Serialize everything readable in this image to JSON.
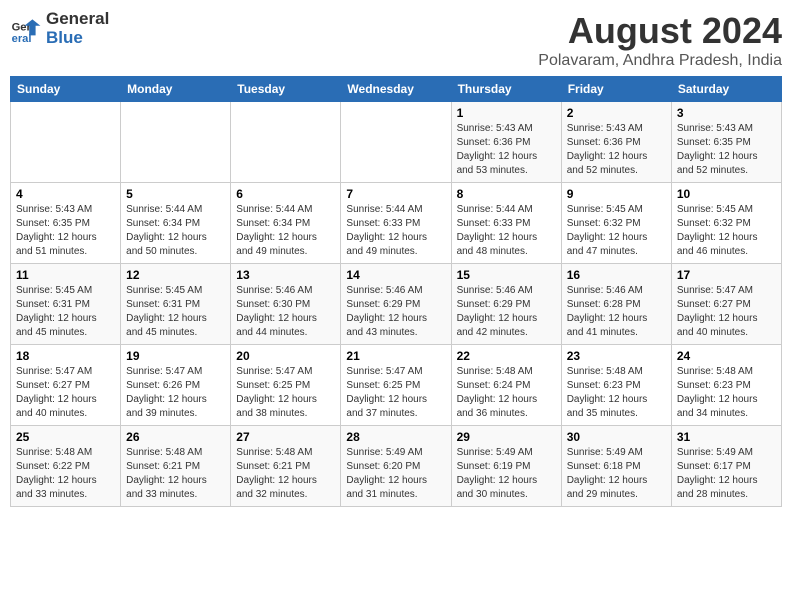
{
  "logo": {
    "general": "General",
    "blue": "Blue"
  },
  "title": "August 2024",
  "subtitle": "Polavaram, Andhra Pradesh, India",
  "weekdays": [
    "Sunday",
    "Monday",
    "Tuesday",
    "Wednesday",
    "Thursday",
    "Friday",
    "Saturday"
  ],
  "weeks": [
    [
      {
        "day": "",
        "info": ""
      },
      {
        "day": "",
        "info": ""
      },
      {
        "day": "",
        "info": ""
      },
      {
        "day": "",
        "info": ""
      },
      {
        "day": "1",
        "info": "Sunrise: 5:43 AM\nSunset: 6:36 PM\nDaylight: 12 hours\nand 53 minutes."
      },
      {
        "day": "2",
        "info": "Sunrise: 5:43 AM\nSunset: 6:36 PM\nDaylight: 12 hours\nand 52 minutes."
      },
      {
        "day": "3",
        "info": "Sunrise: 5:43 AM\nSunset: 6:35 PM\nDaylight: 12 hours\nand 52 minutes."
      }
    ],
    [
      {
        "day": "4",
        "info": "Sunrise: 5:43 AM\nSunset: 6:35 PM\nDaylight: 12 hours\nand 51 minutes."
      },
      {
        "day": "5",
        "info": "Sunrise: 5:44 AM\nSunset: 6:34 PM\nDaylight: 12 hours\nand 50 minutes."
      },
      {
        "day": "6",
        "info": "Sunrise: 5:44 AM\nSunset: 6:34 PM\nDaylight: 12 hours\nand 49 minutes."
      },
      {
        "day": "7",
        "info": "Sunrise: 5:44 AM\nSunset: 6:33 PM\nDaylight: 12 hours\nand 49 minutes."
      },
      {
        "day": "8",
        "info": "Sunrise: 5:44 AM\nSunset: 6:33 PM\nDaylight: 12 hours\nand 48 minutes."
      },
      {
        "day": "9",
        "info": "Sunrise: 5:45 AM\nSunset: 6:32 PM\nDaylight: 12 hours\nand 47 minutes."
      },
      {
        "day": "10",
        "info": "Sunrise: 5:45 AM\nSunset: 6:32 PM\nDaylight: 12 hours\nand 46 minutes."
      }
    ],
    [
      {
        "day": "11",
        "info": "Sunrise: 5:45 AM\nSunset: 6:31 PM\nDaylight: 12 hours\nand 45 minutes."
      },
      {
        "day": "12",
        "info": "Sunrise: 5:45 AM\nSunset: 6:31 PM\nDaylight: 12 hours\nand 45 minutes."
      },
      {
        "day": "13",
        "info": "Sunrise: 5:46 AM\nSunset: 6:30 PM\nDaylight: 12 hours\nand 44 minutes."
      },
      {
        "day": "14",
        "info": "Sunrise: 5:46 AM\nSunset: 6:29 PM\nDaylight: 12 hours\nand 43 minutes."
      },
      {
        "day": "15",
        "info": "Sunrise: 5:46 AM\nSunset: 6:29 PM\nDaylight: 12 hours\nand 42 minutes."
      },
      {
        "day": "16",
        "info": "Sunrise: 5:46 AM\nSunset: 6:28 PM\nDaylight: 12 hours\nand 41 minutes."
      },
      {
        "day": "17",
        "info": "Sunrise: 5:47 AM\nSunset: 6:27 PM\nDaylight: 12 hours\nand 40 minutes."
      }
    ],
    [
      {
        "day": "18",
        "info": "Sunrise: 5:47 AM\nSunset: 6:27 PM\nDaylight: 12 hours\nand 40 minutes."
      },
      {
        "day": "19",
        "info": "Sunrise: 5:47 AM\nSunset: 6:26 PM\nDaylight: 12 hours\nand 39 minutes."
      },
      {
        "day": "20",
        "info": "Sunrise: 5:47 AM\nSunset: 6:25 PM\nDaylight: 12 hours\nand 38 minutes."
      },
      {
        "day": "21",
        "info": "Sunrise: 5:47 AM\nSunset: 6:25 PM\nDaylight: 12 hours\nand 37 minutes."
      },
      {
        "day": "22",
        "info": "Sunrise: 5:48 AM\nSunset: 6:24 PM\nDaylight: 12 hours\nand 36 minutes."
      },
      {
        "day": "23",
        "info": "Sunrise: 5:48 AM\nSunset: 6:23 PM\nDaylight: 12 hours\nand 35 minutes."
      },
      {
        "day": "24",
        "info": "Sunrise: 5:48 AM\nSunset: 6:23 PM\nDaylight: 12 hours\nand 34 minutes."
      }
    ],
    [
      {
        "day": "25",
        "info": "Sunrise: 5:48 AM\nSunset: 6:22 PM\nDaylight: 12 hours\nand 33 minutes."
      },
      {
        "day": "26",
        "info": "Sunrise: 5:48 AM\nSunset: 6:21 PM\nDaylight: 12 hours\nand 33 minutes."
      },
      {
        "day": "27",
        "info": "Sunrise: 5:48 AM\nSunset: 6:21 PM\nDaylight: 12 hours\nand 32 minutes."
      },
      {
        "day": "28",
        "info": "Sunrise: 5:49 AM\nSunset: 6:20 PM\nDaylight: 12 hours\nand 31 minutes."
      },
      {
        "day": "29",
        "info": "Sunrise: 5:49 AM\nSunset: 6:19 PM\nDaylight: 12 hours\nand 30 minutes."
      },
      {
        "day": "30",
        "info": "Sunrise: 5:49 AM\nSunset: 6:18 PM\nDaylight: 12 hours\nand 29 minutes."
      },
      {
        "day": "31",
        "info": "Sunrise: 5:49 AM\nSunset: 6:17 PM\nDaylight: 12 hours\nand 28 minutes."
      }
    ]
  ]
}
